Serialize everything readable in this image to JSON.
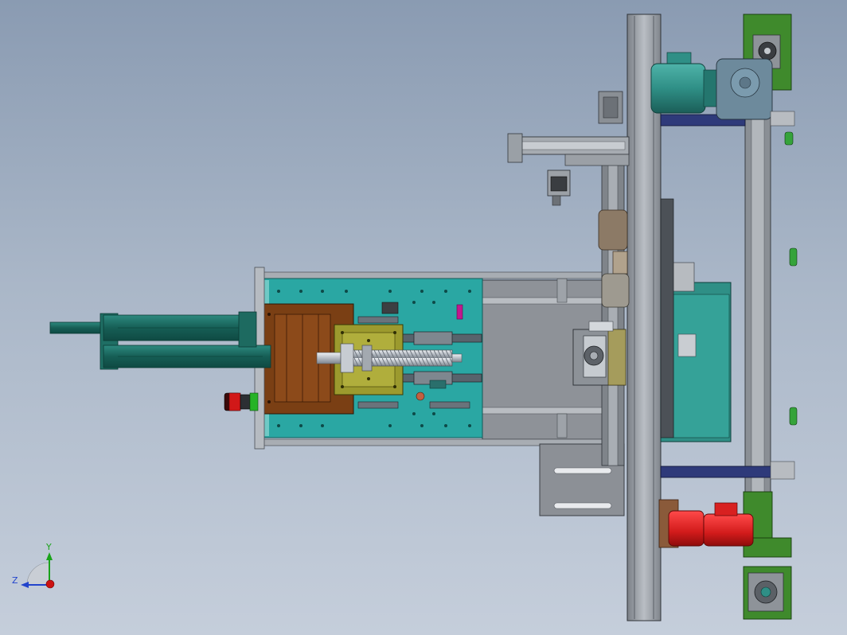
{
  "viewport": {
    "background_top": "#8a9bb2",
    "background_bottom": "#c5cedb"
  },
  "triad": {
    "y_label": "Y",
    "z_label": "Z",
    "y_color": "#1aa31a",
    "z_color": "#2244cc",
    "x_color": "#cc1111"
  },
  "colors": {
    "frame_gray": "#8e9298",
    "cyan_plate": "#2aa7a3",
    "brown_block": "#7a3f14",
    "olive_carriage": "#9c9a2e",
    "teal_cylinder": "#1c6b62",
    "motor_teal": "#2f8f86",
    "green_plate": "#3f8a2c",
    "red_motor": "#d21b1b",
    "navy_bar": "#2e3a7a"
  }
}
